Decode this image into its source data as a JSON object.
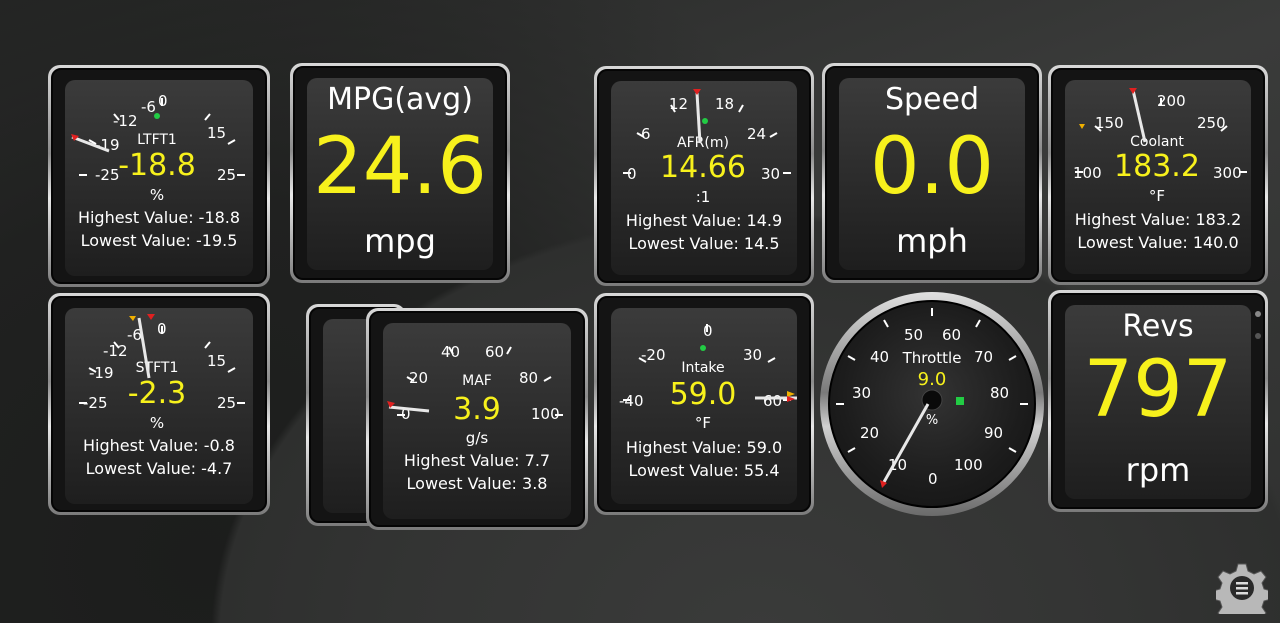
{
  "colors": {
    "value": "#f7f11c",
    "label": "#ffffff",
    "needle": "#ffffff",
    "marker": "#e02020",
    "dot": "#22cc44"
  },
  "gauges": {
    "ltft1": {
      "label": "LTFT1",
      "value": "-18.8",
      "unit": "%",
      "ticks": [
        "-25",
        "-19",
        "-12",
        "-6",
        "0",
        "15",
        "25"
      ],
      "highest": "Highest Value: -18.8",
      "lowest": "Lowest Value: -19.5"
    },
    "stft1": {
      "label": "STFT1",
      "value": "-2.3",
      "unit": "%",
      "ticks": [
        "-25",
        "-19",
        "-12",
        "-6",
        "0",
        "15",
        "25"
      ],
      "highest": "Highest Value: -0.8",
      "lowest": "Lowest Value: -4.7"
    },
    "afr": {
      "label": "AFR(m)",
      "value": "14.66",
      "unit": ":1",
      "ticks": [
        "0",
        "6",
        "12",
        "18",
        "24",
        "30"
      ],
      "highest": "Highest Value: 14.9",
      "lowest": "Lowest Value: 14.5"
    },
    "coolant": {
      "label": "Coolant",
      "value": "183.2",
      "unit": "°F",
      "ticks": [
        "100",
        "150",
        "200",
        "250",
        "300"
      ],
      "highest": "Highest Value: 183.2",
      "lowest": "Lowest Value: 140.0"
    },
    "maf": {
      "label": "MAF",
      "value": "3.9",
      "unit": "g/s",
      "ticks": [
        "0",
        "20",
        "40",
        "60",
        "80",
        "100"
      ],
      "highest": "Highest Value: 7.7",
      "lowest": "Lowest Value: 3.8"
    },
    "intake": {
      "label": "Intake",
      "value": "59.0",
      "unit": "°F",
      "ticks": [
        "-40",
        "-20",
        "0",
        "30",
        "60"
      ],
      "highest": "Highest Value: 59.0",
      "lowest": "Lowest Value: 55.4"
    },
    "throttle": {
      "label": "Throttle",
      "value": "9.0",
      "unit": "%",
      "ticks": [
        "0",
        "10",
        "20",
        "30",
        "40",
        "50",
        "60",
        "70",
        "80",
        "90",
        "100"
      ]
    }
  },
  "digital": {
    "mpg": {
      "label": "MPG(avg)",
      "value": "24.6",
      "unit": "mpg"
    },
    "speed": {
      "label": "Speed",
      "value": "0.0",
      "unit": "mph"
    },
    "revs": {
      "label": "Revs",
      "value": "797",
      "unit": "rpm"
    }
  },
  "settings": {
    "icon": "gear-menu-icon"
  }
}
